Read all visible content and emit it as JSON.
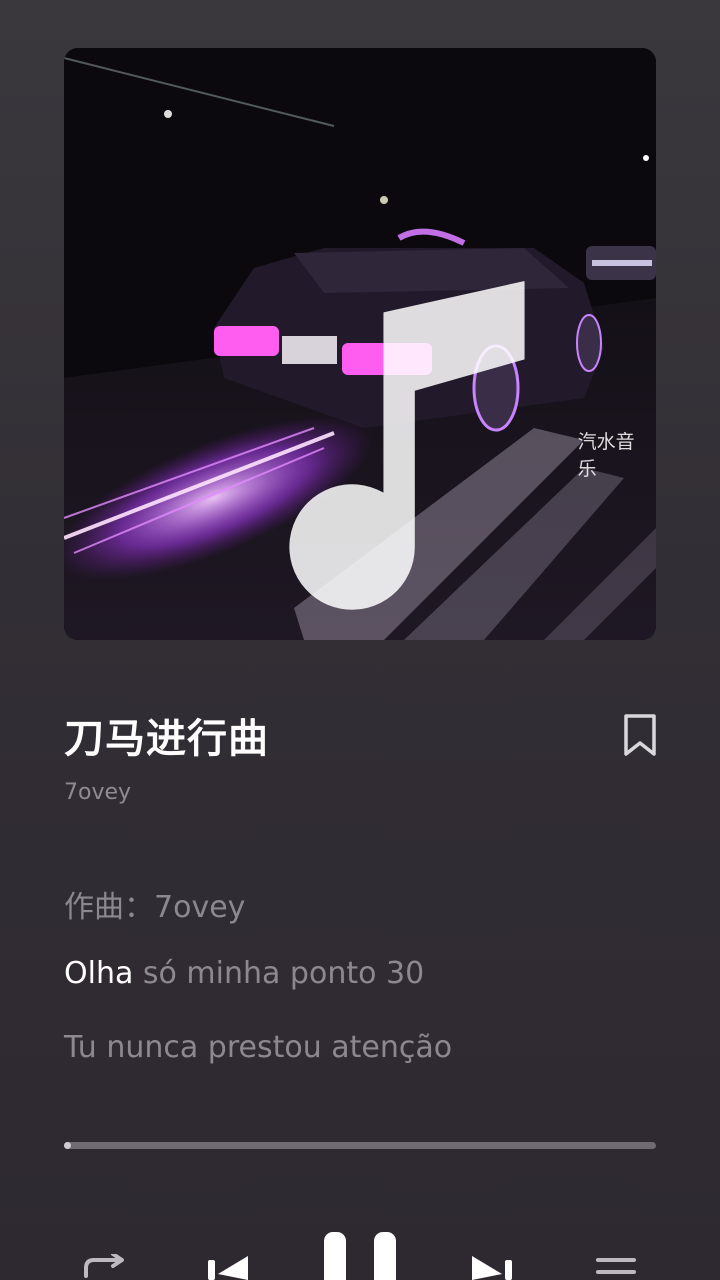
{
  "player": {
    "title": "刀马进行曲",
    "artist": "7ovey",
    "watermark": "汽水音乐",
    "progress_fraction": 0.01
  },
  "lyrics": {
    "line1": "作曲：7ovey",
    "line2_highlight": "Olha",
    "line2_rest": " só minha ponto 30",
    "line3": "Tu nunca prestou atenção"
  },
  "icons": {
    "bookmark": "bookmark-icon",
    "repeat": "repeat-icon",
    "previous": "previous-icon",
    "pause": "pause-icon",
    "next": "next-icon",
    "playlist": "playlist-icon"
  },
  "colors": {
    "accent_purple": "#c35bff",
    "background": "#322e35"
  }
}
